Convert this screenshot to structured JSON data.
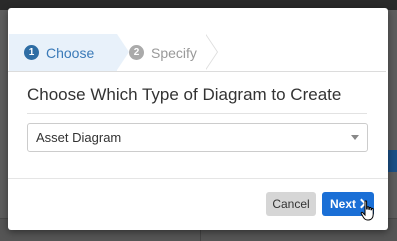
{
  "wizard": {
    "steps": [
      {
        "number": "1",
        "label": "Choose",
        "state": "active"
      },
      {
        "number": "2",
        "label": "Specify",
        "state": "inactive"
      }
    ]
  },
  "dialog": {
    "heading": "Choose Which Type of Diagram to Create",
    "diagram_type_select": {
      "value": "Asset Diagram"
    }
  },
  "buttons": {
    "cancel": "Cancel",
    "next": "Next"
  },
  "colors": {
    "active_step_bg": "#e8f1fa",
    "active_step_text": "#3a7ab8",
    "primary": "#1a6fd6",
    "secondary_button": "#d6d6d6"
  },
  "icons": {
    "next": "chevron-right-icon",
    "select": "caret-down-icon",
    "cursor": "hand-pointer-cursor"
  }
}
